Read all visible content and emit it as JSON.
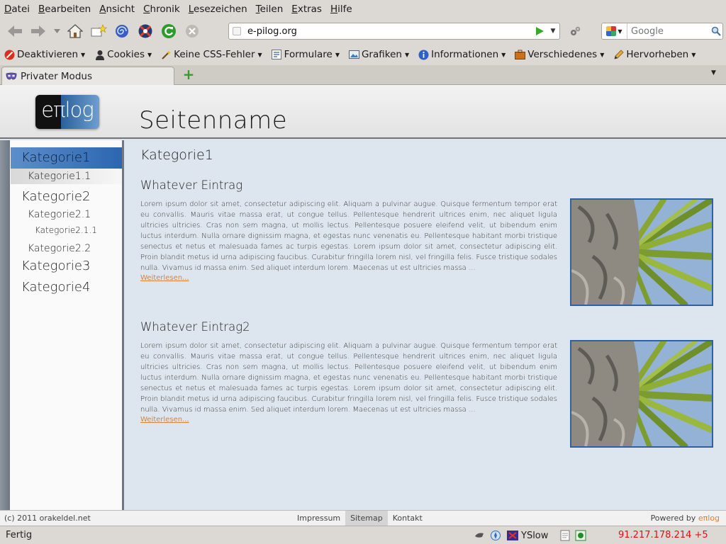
{
  "menu": [
    "Datei",
    "Bearbeiten",
    "Ansicht",
    "Chronik",
    "Lesezeichen",
    "Teilen",
    "Extras",
    "Hilfe"
  ],
  "nav_buttons": [
    "back-icon",
    "forward-icon",
    "history-dropdown-icon",
    "home-icon",
    "bookmark-star-icon",
    "spiral-addon-icon",
    "compass-addon-icon",
    "reload-icon",
    "stop-icon"
  ],
  "url": "e-pilog.org",
  "search": {
    "placeholder": "Google",
    "engine": "google-icon"
  },
  "dev_toolbar": [
    {
      "label": "Deaktivieren",
      "icon": "no-entry-icon"
    },
    {
      "label": "Cookies",
      "icon": "person-icon"
    },
    {
      "label": "Keine CSS-Fehler",
      "icon": "wand-icon"
    },
    {
      "label": "Formulare",
      "icon": "form-icon"
    },
    {
      "label": "Grafiken",
      "icon": "image-icon"
    },
    {
      "label": "Informationen",
      "icon": "info-icon"
    },
    {
      "label": "Verschiedenes",
      "icon": "briefcase-icon"
    },
    {
      "label": "Hervorheben",
      "icon": "pencil-icon"
    }
  ],
  "tab": {
    "label": "Privater Modus"
  },
  "site": {
    "logo": "eπlog",
    "name": "Seitenname",
    "nav": [
      {
        "label": "Kategorie1",
        "level": 1,
        "state": "active"
      },
      {
        "label": "Kategorie1.1",
        "level": 2,
        "state": "sub-active"
      },
      {
        "label": "Kategorie2",
        "level": 1,
        "state": ""
      },
      {
        "label": "Kategorie2.1",
        "level": 2,
        "state": ""
      },
      {
        "label": "Kategorie2.1.1",
        "level": 3,
        "state": ""
      },
      {
        "label": "Kategorie2.2",
        "level": 2,
        "state": ""
      },
      {
        "label": "Kategorie3",
        "level": 1,
        "state": ""
      },
      {
        "label": "Kategorie4",
        "level": 1,
        "state": ""
      }
    ],
    "category_title": "Kategorie1",
    "entries": [
      {
        "title": "Whatever Eintrag",
        "text": "Lorem ipsum dolor sit amet, consectetur adipiscing elit. Aliquam a pulvinar augue. Quisque fermentum tempor erat eu convallis. Mauris vitae massa erat, ut congue tellus. Pellentesque hendrerit ultrices enim, nec aliquet ligula ultricies ultricies. Cras non sem magna, ut mollis lectus. Pellentesque posuere eleifend velit, ut bibendum enim luctus interdum. Nulla ornare dignissim magna, et egestas nunc venenatis eu. Pellentesque habitant morbi tristique senectus et netus et malesuada fames ac turpis egestas. Lorem ipsum dolor sit amet, consectetur adipiscing elit. Proin blandit metus id urna adipiscing faucibus. Curabitur fringilla lorem nisl, vel fringilla felis. Fusce tristique sodales nulla. Vivamus id massa enim. Sed aliquet interdum lorem. Maecenas ut est ultricies massa ...",
        "more": "Weiterlesen..."
      },
      {
        "title": "Whatever Eintrag2",
        "text": "Lorem ipsum dolor sit amet, consectetur adipiscing elit. Aliquam a pulvinar augue. Quisque fermentum tempor erat eu convallis. Mauris vitae massa erat, ut congue tellus. Pellentesque hendrerit ultrices enim, nec aliquet ligula ultricies ultricies. Cras non sem magna, ut mollis lectus. Pellentesque posuere eleifend velit, ut bibendum enim luctus interdum. Nulla ornare dignissim magna, et egestas nunc venenatis eu. Pellentesque habitant morbi tristique senectus et netus et malesuada fames ac turpis egestas. Lorem ipsum dolor sit amet, consectetur adipiscing elit. Proin blandit metus id urna adipiscing faucibus. Curabitur fringilla lorem nisl, vel fringilla felis. Fusce tristique sodales nulla. Vivamus id massa enim. Sed aliquet interdum lorem. Maecenas ut est ultricies massa ...",
        "more": "Weiterlesen..."
      }
    ],
    "footer": {
      "copyright": "(c) 2011 orakeldel.net",
      "links": [
        "Impressum",
        "Sitemap",
        "Kontakt"
      ],
      "selected_link": "Sitemap",
      "powered_prefix": "Powered by",
      "powered_name": "eπlog"
    }
  },
  "statusbar": {
    "status": "Fertig",
    "yslow": "YSlow",
    "ip": "91.217.178.214 +5"
  },
  "colors": {
    "accent": "#2b66b0",
    "link": "#d9823c",
    "content_bg": "#dde6ef",
    "ip_red": "#dd1111"
  }
}
